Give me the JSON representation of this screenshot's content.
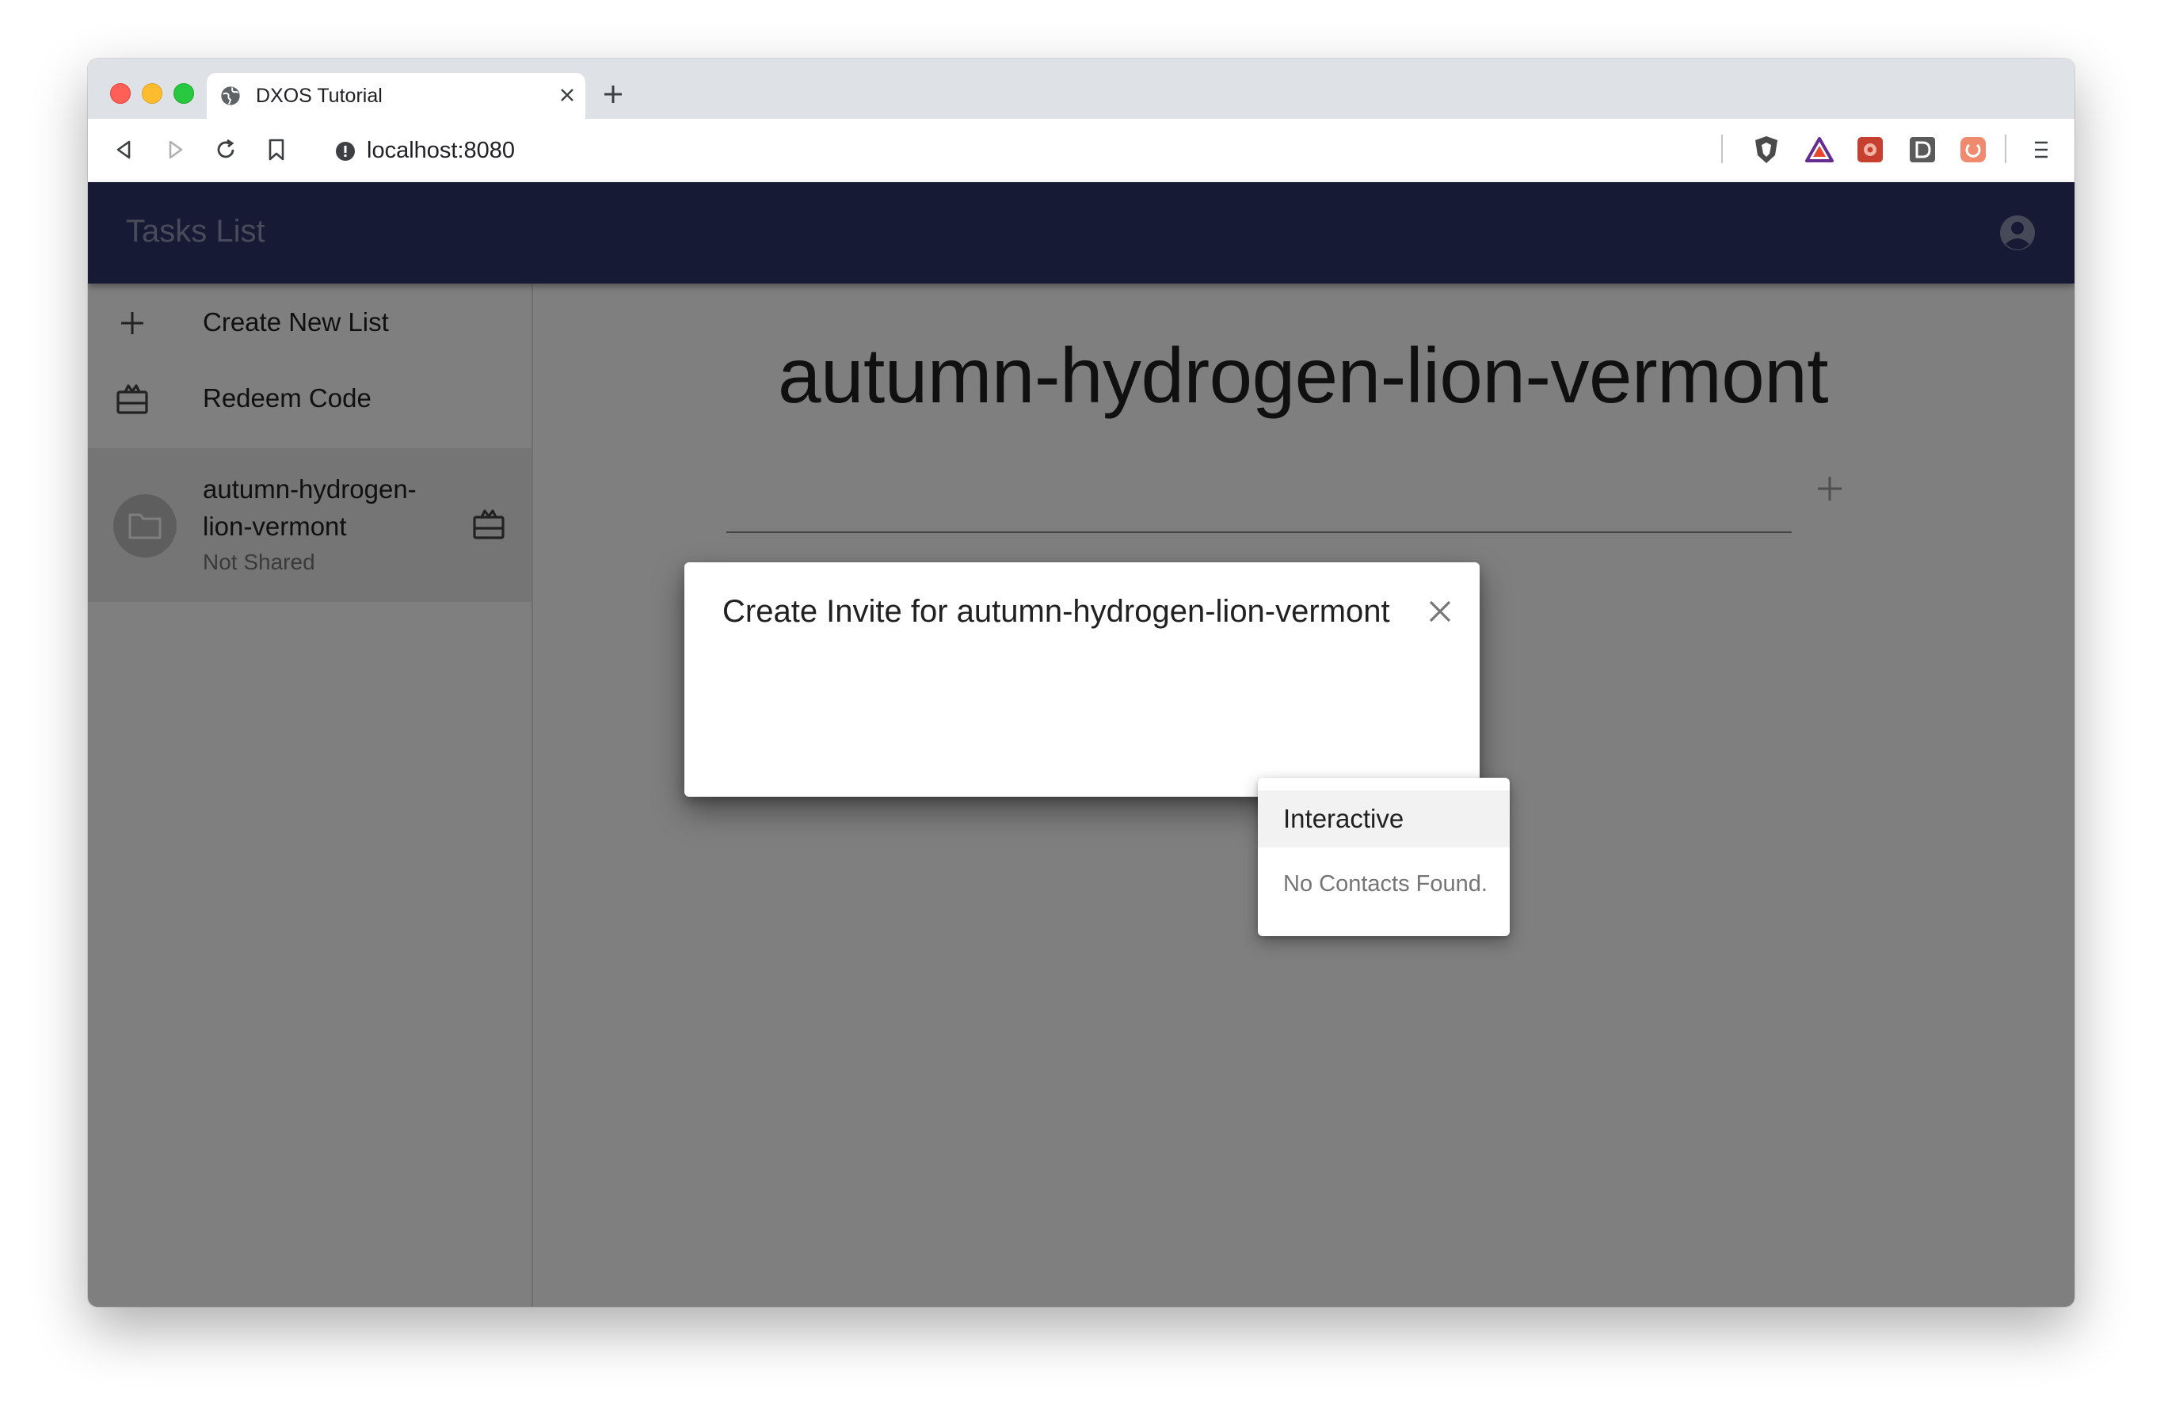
{
  "browser": {
    "tab_title": "DXOS Tutorial",
    "url": "localhost:8080"
  },
  "app": {
    "title": "Tasks List"
  },
  "sidebar": {
    "items": [
      {
        "label": "Create New List",
        "icon": "plus-icon"
      },
      {
        "label": "Redeem Code",
        "icon": "redeem-icon"
      }
    ],
    "lists": [
      {
        "name": "autumn-hydrogen-lion-vermont",
        "status": "Not Shared",
        "icon": "folder-icon"
      }
    ]
  },
  "main": {
    "list_title": "autumn-hydrogen-lion-vermont"
  },
  "dialog": {
    "title": "Create Invite for autumn-hydrogen-lion-vermont"
  },
  "menu": {
    "item_label": "Interactive",
    "note": "No Contacts Found."
  },
  "colors": {
    "app_bar": "#2c3568",
    "overlay": "rgba(0,0,0,0.5)"
  }
}
